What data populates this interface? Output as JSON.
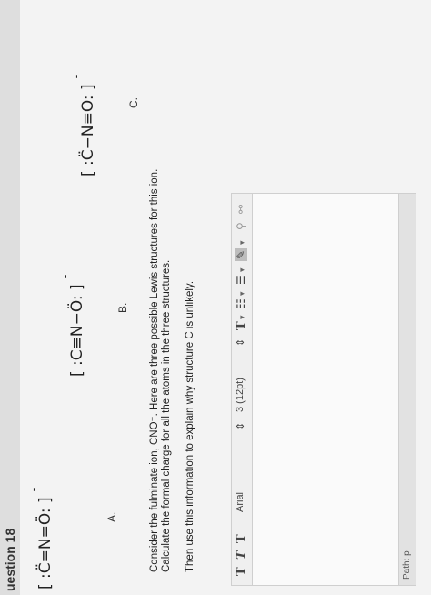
{
  "question_title": "uestion 18",
  "structures": [
    {
      "formula": "[ :C̈=N=Ö: ]",
      "charge": "-",
      "letter": "A."
    },
    {
      "formula": "[ :C≡N−Ö: ]",
      "charge": "-",
      "letter": "B."
    },
    {
      "formula": "[ :C̈−N≡O: ]",
      "charge": "-",
      "letter": "C."
    }
  ],
  "prompt": {
    "line1": "Consider the fulminate ion, CNO⁻. Here are three possible Lewis structures for this ion.",
    "line2": "Calculate the formal charge for all the atoms in the three structures.",
    "line3": "Then use this information to explain why structure C is unlikely."
  },
  "toolbar": {
    "bold": "T",
    "italic": "T",
    "underline": "T",
    "font": "Arial",
    "font_arrow": "⇕",
    "size": "3 (12pt)",
    "size_arrow": "⇕",
    "text_color": "T",
    "bullets": "☷",
    "numbers": "☰",
    "highlight": "✎",
    "dropdown": "▾",
    "link": "⚲",
    "unlink": "⚯"
  },
  "path_label": "Path: p"
}
